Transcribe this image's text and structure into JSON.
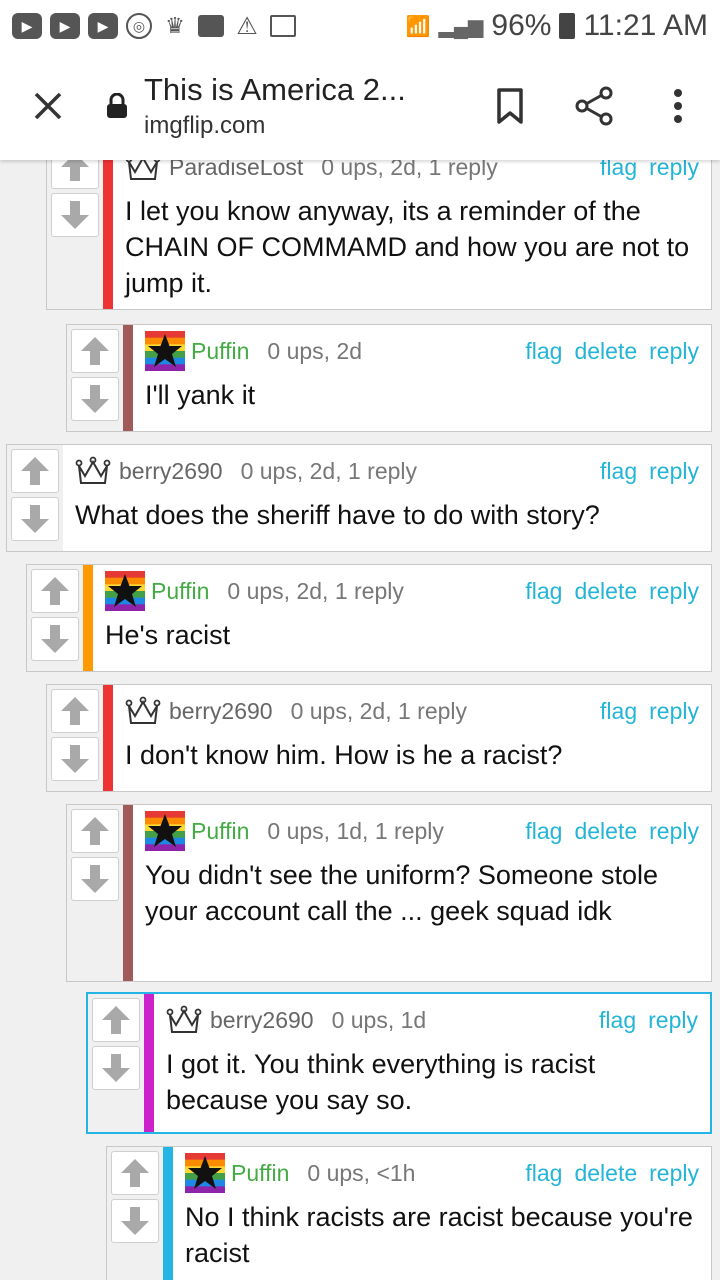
{
  "status": {
    "battery": "96%",
    "time": "11:21 AM"
  },
  "appbar": {
    "title": "This is America 2...",
    "domain": "imgflip.com"
  },
  "actions": {
    "flag": "flag",
    "delete": "delete",
    "reply": "reply"
  },
  "comments": [
    {
      "user": "ParadiseLost",
      "meta": "0 ups, 2d, 1 reply",
      "text": "I let you know anyway, its a reminder of the CHAIN OF COMMAMD and how you are not to jump it.",
      "own": false
    },
    {
      "user": "Puffin",
      "meta": "0 ups, 2d",
      "text": "I'll yank it",
      "own": true
    },
    {
      "user": "berry2690",
      "meta": "0 ups, 2d, 1 reply",
      "text": "What does the sheriff have to do with story?",
      "own": false
    },
    {
      "user": "Puffin",
      "meta": "0 ups, 2d, 1 reply",
      "text": "He's racist",
      "own": true
    },
    {
      "user": "berry2690",
      "meta": "0 ups, 2d, 1 reply",
      "text": "I don't know him. How is he a racist?",
      "own": false
    },
    {
      "user": "Puffin",
      "meta": "0 ups, 1d, 1 reply",
      "text": "You didn't see the uniform? Someone stole your account call the ... geek squad idk",
      "own": true
    },
    {
      "user": "berry2690",
      "meta": "0 ups, 1d",
      "text": "I got it. You think everything is racist because you say so.",
      "own": false
    },
    {
      "user": "Puffin",
      "meta": "0 ups, <1h",
      "text": "No I think racists are racist because you're racist",
      "own": true
    }
  ]
}
